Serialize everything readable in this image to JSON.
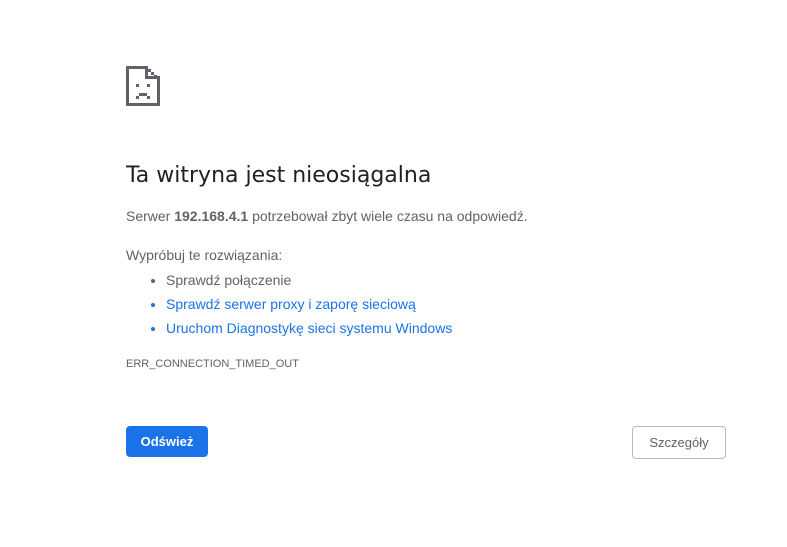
{
  "page": {
    "icon": "sad-page-icon",
    "title": "Ta witryna jest nieosiągalna",
    "description": {
      "prefix": "Serwer ",
      "host": "192.168.4.1",
      "suffix": " potrzebował zbyt wiele czasu na odpowiedź."
    },
    "suggestions_heading": "Wypróbuj te rozwiązania:",
    "suggestions": [
      "Sprawdź połączenie",
      "Sprawdź serwer proxy i zaporę sieciową",
      "Uruchom Diagnostykę sieci systemu Windows"
    ],
    "error_code": "ERR_CONNECTION_TIMED_OUT"
  },
  "buttons": {
    "reload": "Odśwież",
    "details": "Szczegóły"
  },
  "colors": {
    "accent": "#1a73e8",
    "text": "#5f6368",
    "heading": "#202124"
  }
}
